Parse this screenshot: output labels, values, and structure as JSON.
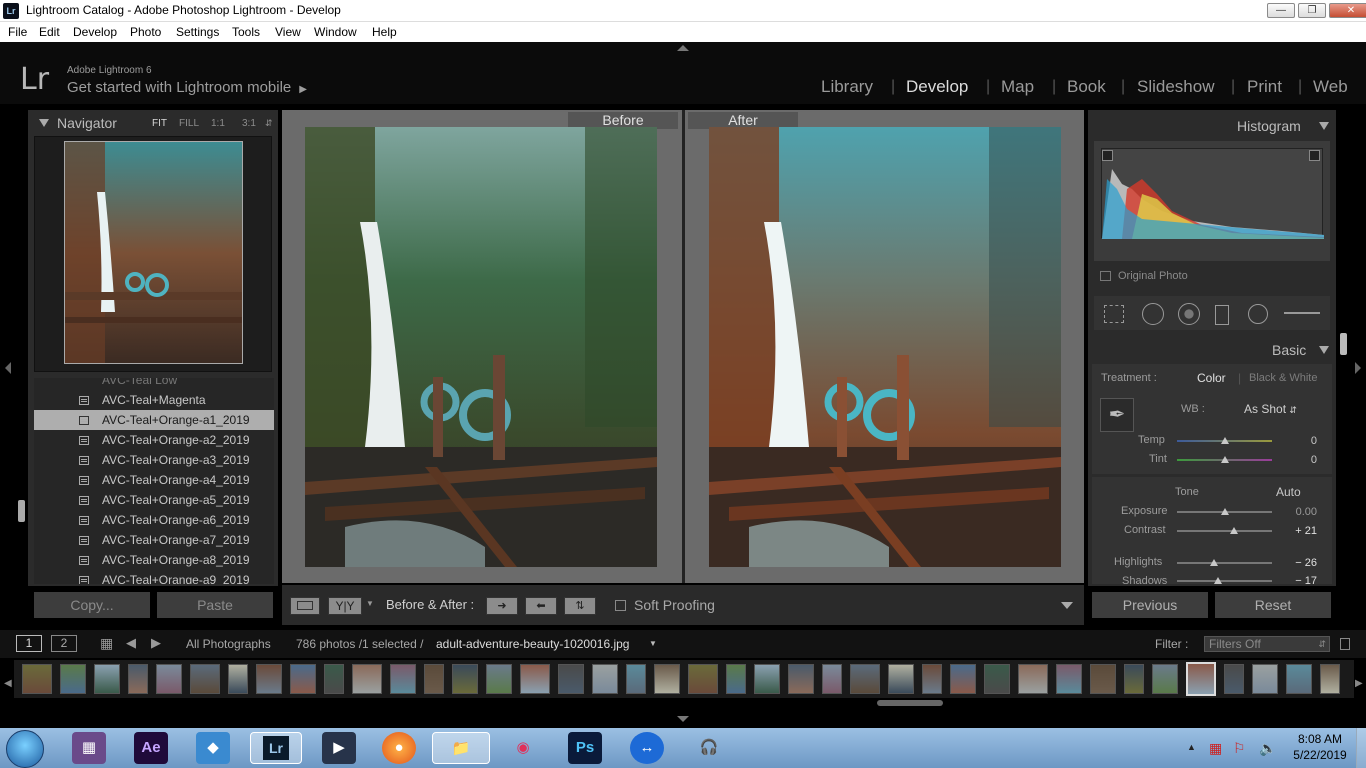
{
  "window": {
    "title": "Lightroom Catalog - Adobe Photoshop Lightroom - Develop",
    "app_icon": "Lr"
  },
  "menubar": [
    "File",
    "Edit",
    "Develop",
    "Photo",
    "Settings",
    "Tools",
    "View",
    "Window",
    "Help"
  ],
  "header": {
    "logo": "Lr",
    "brand_line1": "Adobe Lightroom 6",
    "brand_line2": "Get started with Lightroom mobile",
    "modules": [
      "Library",
      "Develop",
      "Map",
      "Book",
      "Slideshow",
      "Print",
      "Web"
    ],
    "active_module": "Develop"
  },
  "navigator": {
    "title": "Navigator",
    "zoom_options": [
      "FIT",
      "FILL",
      "1:1",
      "3:1"
    ]
  },
  "presets": {
    "items": [
      "AVC-Teal Low",
      "AVC-Teal+Magenta",
      "AVC-Teal+Orange-a1_2019",
      "AVC-Teal+Orange-a2_2019",
      "AVC-Teal+Orange-a3_2019",
      "AVC-Teal+Orange-a4_2019",
      "AVC-Teal+Orange-a5_2019",
      "AVC-Teal+Orange-a6_2019",
      "AVC-Teal+Orange-a7_2019",
      "AVC-Teal+Orange-a8_2019",
      "AVC-Teal+Orange-a9_2019"
    ],
    "selected": "AVC-Teal+Orange-a1_2019"
  },
  "left_buttons": {
    "copy": "Copy...",
    "paste": "Paste"
  },
  "view": {
    "before_label": "Before",
    "after_label": "After"
  },
  "toolbar": {
    "view_mode": "Y|Y",
    "ba_label": "Before & After :",
    "soft_proofing": "Soft Proofing"
  },
  "histogram": {
    "title": "Histogram",
    "original_photo": "Original Photo"
  },
  "basic": {
    "title": "Basic",
    "treatment_label": "Treatment :",
    "treatment_color": "Color",
    "treatment_bw": "Black & White",
    "wb_label": "WB :",
    "wb_value": "As Shot",
    "temp_label": "Temp",
    "temp_value": "0",
    "tint_label": "Tint",
    "tint_value": "0",
    "tone_label": "Tone",
    "auto_label": "Auto",
    "exposure_label": "Exposure",
    "exposure_value": "0.00",
    "contrast_label": "Contrast",
    "contrast_value": "+ 21",
    "highlights_label": "Highlights",
    "highlights_value": "− 26",
    "shadows_label": "Shadows",
    "shadows_value": "− 17"
  },
  "right_buttons": {
    "previous": "Previous",
    "reset": "Reset"
  },
  "filmstrip_bar": {
    "page1": "1",
    "page2": "2",
    "source": "All Photographs",
    "count": "786 photos /1 selected /",
    "filename": "adult-adventure-beauty-1020016.jpg",
    "filter_label": "Filter :",
    "filter_value": "Filters Off"
  },
  "taskbar": {
    "time": "8:08 AM",
    "date": "5/22/2019",
    "apps": [
      "Ae",
      "Lr",
      "Ps"
    ]
  }
}
